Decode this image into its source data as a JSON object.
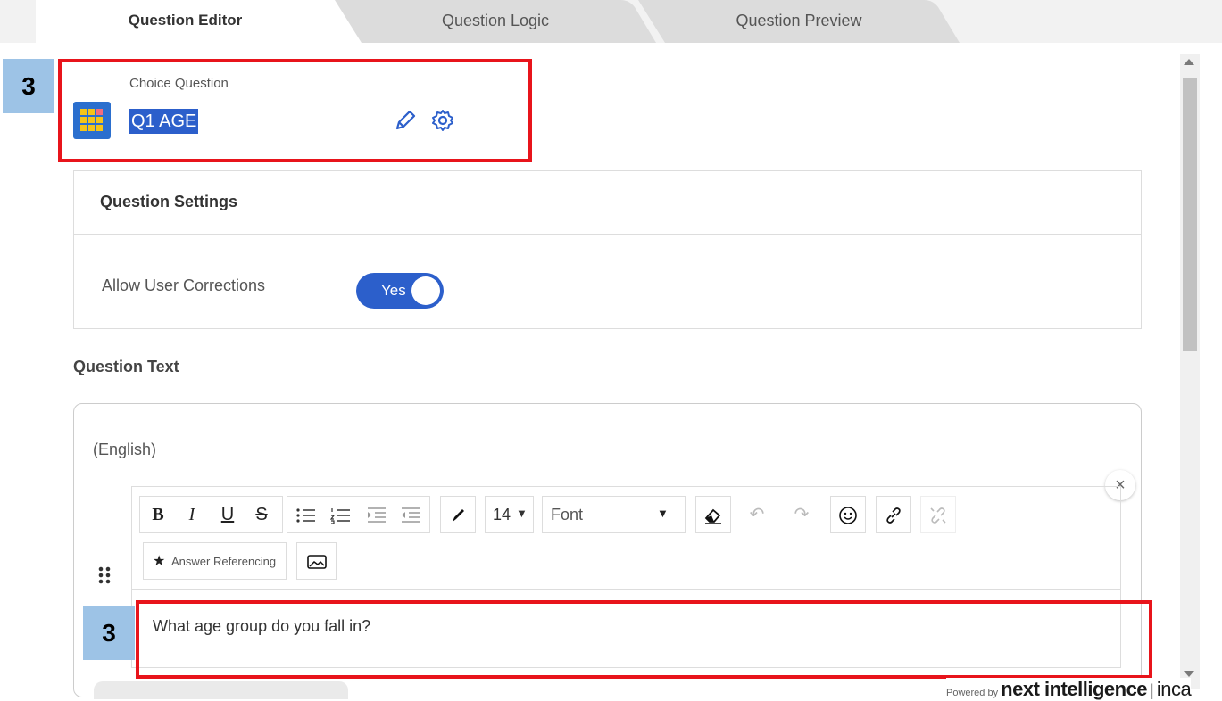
{
  "tabs": [
    {
      "label": "Question Editor",
      "active": true
    },
    {
      "label": "Question Logic",
      "active": false
    },
    {
      "label": "Question Preview",
      "active": false
    }
  ],
  "annotations": {
    "step_top": "3",
    "step_bottom": "3"
  },
  "question": {
    "type_label": "Choice Question",
    "name": "Q1 AGE"
  },
  "settings": {
    "title": "Question Settings",
    "allow_corrections_label": "Allow User Corrections",
    "allow_corrections_value": "Yes"
  },
  "question_text": {
    "section_title": "Question Text",
    "language": "(English)",
    "content": "What age group do you fall in?"
  },
  "toolbar": {
    "font_size": "14",
    "font_label": "Font",
    "answer_referencing": "Answer Referencing"
  },
  "footer": {
    "powered_by": "Powered by",
    "brand_a": "next intelligence",
    "brand_b": "inca"
  },
  "colors": {
    "accent": "#2c5fcb",
    "highlight": "#e8141b",
    "badge": "#9dc3e6"
  }
}
